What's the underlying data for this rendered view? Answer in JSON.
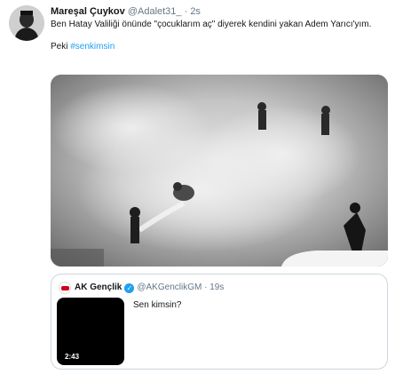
{
  "tweet": {
    "author_name": "Mareşal Çuykov",
    "handle_time": "@Adalet31_ · 2s",
    "text_line1": "Ben Hatay Valiliği önünde \"çocuklarım aç\" diyerek kendini yakan Adem Yarıcı'yım.",
    "text_prefix": "Peki ",
    "hashtag": "#senkimsin"
  },
  "quoted": {
    "name": "AK Gençlik",
    "verified_mark": "✓",
    "handle_time": "@AKGenclikGM · 19s",
    "text": "Sen kimsin?",
    "video_duration": "2:43"
  },
  "colors": {
    "accent": "#1da1f2",
    "secondary_text": "#657786",
    "border": "#ccd6dd"
  }
}
